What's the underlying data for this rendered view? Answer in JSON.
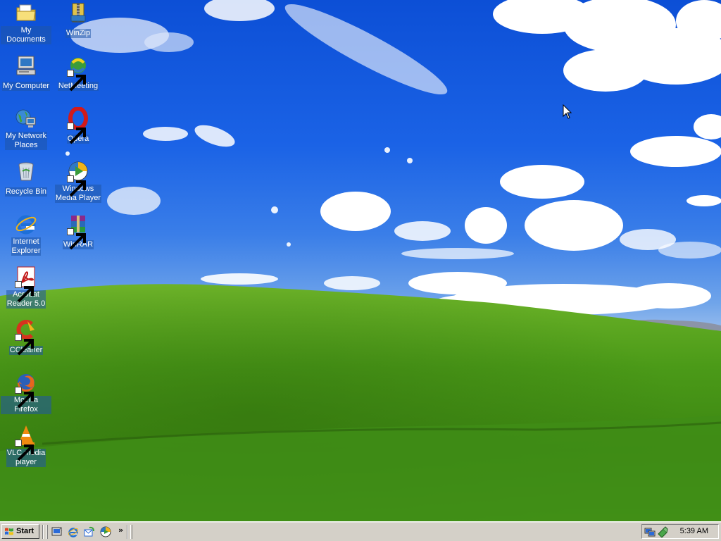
{
  "desktop": {
    "icons": [
      {
        "name": "my-documents-icon",
        "label": "My Documents"
      },
      {
        "name": "my-computer-icon",
        "label": "My Computer"
      },
      {
        "name": "my-network-places-icon",
        "label": "My Network\nPlaces"
      },
      {
        "name": "recycle-bin-icon",
        "label": "Recycle Bin"
      },
      {
        "name": "internet-explorer-icon",
        "label": "Internet\nExplorer"
      },
      {
        "name": "acrobat-reader-icon",
        "label": "Acrobat\nReader 5.0"
      },
      {
        "name": "ccleaner-icon",
        "label": "CCleaner"
      },
      {
        "name": "mozilla-firefox-icon",
        "label": "Mozilla Firefox"
      },
      {
        "name": "vlc-media-player-icon",
        "label": "VLC media\nplayer"
      },
      {
        "name": "winzip-icon",
        "label": "WinZip"
      },
      {
        "name": "netmeeting-icon",
        "label": "NetMeeting"
      },
      {
        "name": "opera-icon",
        "label": "Opera"
      },
      {
        "name": "windows-media-player-icon",
        "label": "Windows\nMedia Player"
      },
      {
        "name": "winrar-icon",
        "label": "WinRAR"
      }
    ]
  },
  "taskbar": {
    "start_label": "Start",
    "quick_launch": [
      "show-desktop-icon",
      "internet-explorer-icon",
      "outlook-express-icon",
      "windows-media-player-icon"
    ],
    "tray_icons": [
      "network-connection-icon",
      "safely-remove-hardware-icon"
    ],
    "clock": "5:39 AM"
  },
  "colors": {
    "sky": "#1b63e6",
    "grass": "#4f9a1c",
    "taskbar": "#d4d0c8",
    "icon_label_bg": "#1f56a8"
  }
}
